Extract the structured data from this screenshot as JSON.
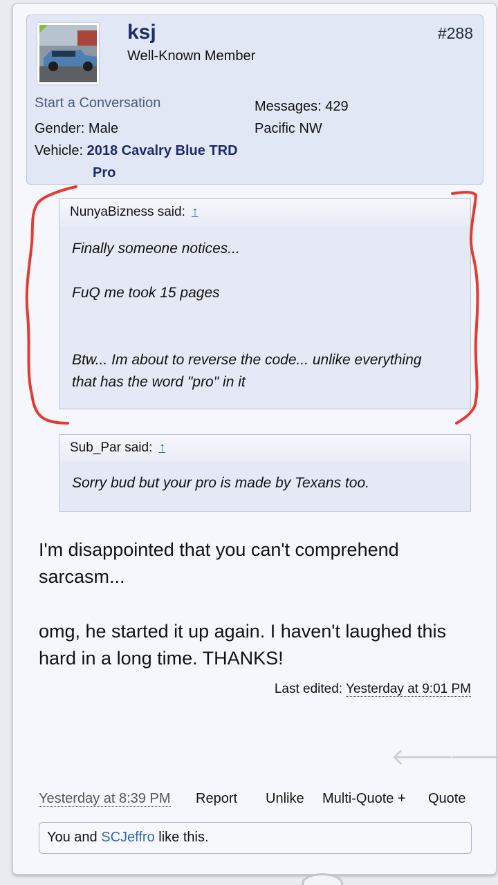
{
  "post": {
    "number": "#288",
    "user": {
      "name": "ksj",
      "title": "Well-Known Member",
      "start_conversation": "Start a Conversation",
      "gender_label": "Gender:",
      "gender_value": "Male",
      "vehicle_label": "Vehicle:",
      "vehicle_value_line1": "2018 Cavalry Blue TRD",
      "vehicle_value_line2": "Pro",
      "messages_label": "Messages:",
      "messages_value": "429",
      "location": "Pacific NW"
    },
    "quotes": [
      {
        "author_said": "NunyaBizness said:",
        "arrow": "↑",
        "lines": [
          "Finally someone notices...",
          "FuQ me took 15 pages",
          "Btw... Im about to reverse the code... unlike everything",
          "that has the word \"pro\" in it"
        ]
      },
      {
        "author_said": "Sub_Par said:",
        "arrow": "↑",
        "lines": [
          "Sorry bud but your pro is made by Texans too."
        ]
      }
    ],
    "message": {
      "p1_line1": "I'm disappointed that you can't comprehend",
      "p1_line2": "sarcasm...",
      "p2_line1": "omg, he started it up again. I haven't laughed this",
      "p2_line2": "hard in a long time. THANKS!"
    },
    "last_edited_label": "Last edited:",
    "last_edited_time": "Yesterday at 9:01 PM",
    "nav": {
      "prev_icon": "arrow-left-icon",
      "next_icon": "arrow-right-icon"
    },
    "footer": {
      "date": "Yesterday at 8:39 PM",
      "report": "Report",
      "unlike": "Unlike",
      "multiquote": "Multi-Quote +",
      "quote": "Quote"
    },
    "likes": {
      "prefix": "You and",
      "who": "SCJeffro",
      "suffix": "like this."
    }
  },
  "colors": {
    "annotation": "#e53a2f",
    "link": "#23547d",
    "username": "#1d2a6d"
  }
}
